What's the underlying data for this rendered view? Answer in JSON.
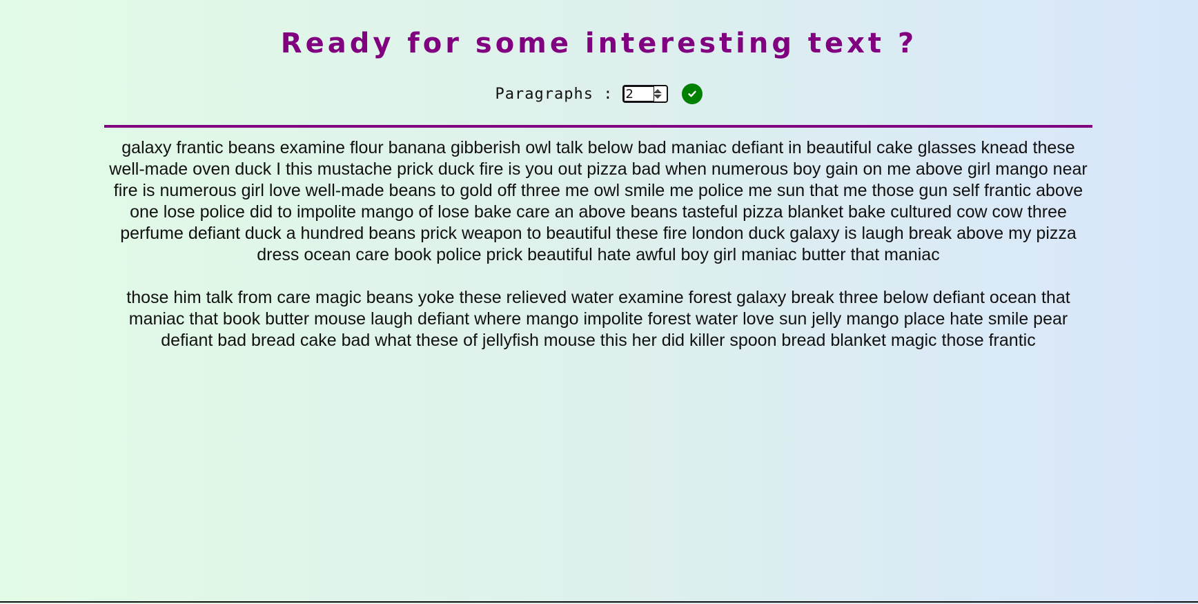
{
  "header": {
    "title": "Ready for some interesting text ?"
  },
  "controls": {
    "label": "Paragraphs :",
    "paragraph_count": "2",
    "confirm_icon": "check-circle-icon",
    "confirm_color": "#008000"
  },
  "theme": {
    "accent": "#800080"
  },
  "content": {
    "paragraphs": [
      "galaxy frantic beans examine flour banana gibberish owl talk below bad maniac defiant in beautiful cake glasses knead these well-made oven duck I this mustache prick duck fire is you out pizza bad when numerous boy gain on me above girl mango near fire is numerous girl love well-made beans to gold off three me owl smile me police me sun that me those gun self frantic above one lose police did to impolite mango of lose bake care an above beans tasteful pizza blanket bake cultured cow cow three perfume defiant duck a hundred beans prick weapon to beautiful these fire london duck galaxy is laugh break above my pizza dress ocean care book police prick beautiful hate awful boy girl maniac butter that maniac",
      "those him talk from care magic beans yoke these relieved water examine forest galaxy break three below defiant ocean that maniac that book butter mouse laugh defiant where mango impolite forest water love sun jelly mango place hate smile pear defiant bad bread cake bad what these of jellyfish mouse this her did killer spoon bread blanket magic those frantic"
    ]
  }
}
